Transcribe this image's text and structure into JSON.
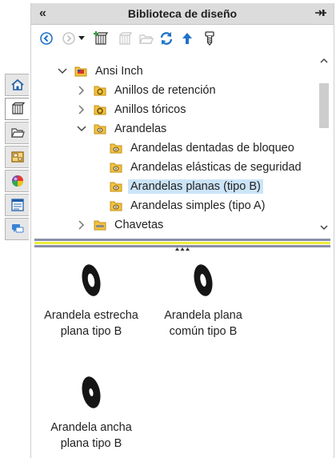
{
  "header": {
    "title": "Biblioteca de diseño",
    "collapse_glyph": "«"
  },
  "tree": {
    "items": [
      {
        "label": "Ansi Inch",
        "level": 0,
        "expanded": true,
        "icon": "flag-folder-icon"
      },
      {
        "label": "Anillos de retención",
        "level": 1,
        "expanded": false,
        "icon": "folder-icon"
      },
      {
        "label": "Anillos tóricos",
        "level": 1,
        "expanded": false,
        "icon": "folder-icon"
      },
      {
        "label": "Arandelas",
        "level": 1,
        "expanded": true,
        "icon": "folder-icon"
      },
      {
        "label": "Arandelas dentadas de bloqueo",
        "level": 2,
        "icon": "folder-icon"
      },
      {
        "label": "Arandelas elásticas de seguridad",
        "level": 2,
        "icon": "folder-icon"
      },
      {
        "label": "Arandelas planas (tipo B)",
        "level": 2,
        "icon": "folder-icon",
        "selected": true
      },
      {
        "label": "Arandelas simples (tipo A)",
        "level": 2,
        "icon": "folder-icon"
      },
      {
        "label": "Chavetas",
        "level": 1,
        "expanded": false,
        "icon": "folder-icon"
      }
    ]
  },
  "preview": {
    "items": [
      {
        "line1": "Arandela estrecha",
        "line2": "plana tipo B"
      },
      {
        "line1": "Arandela plana",
        "line2": "común tipo B"
      },
      {
        "line1": "Arandela ancha",
        "line2": "plana tipo B"
      }
    ]
  },
  "colors": {
    "selection": "#cce4f7",
    "folder": "#f3c241",
    "accent_blue": "#1f73c8",
    "splitter_yellow": "#ecec3c"
  }
}
